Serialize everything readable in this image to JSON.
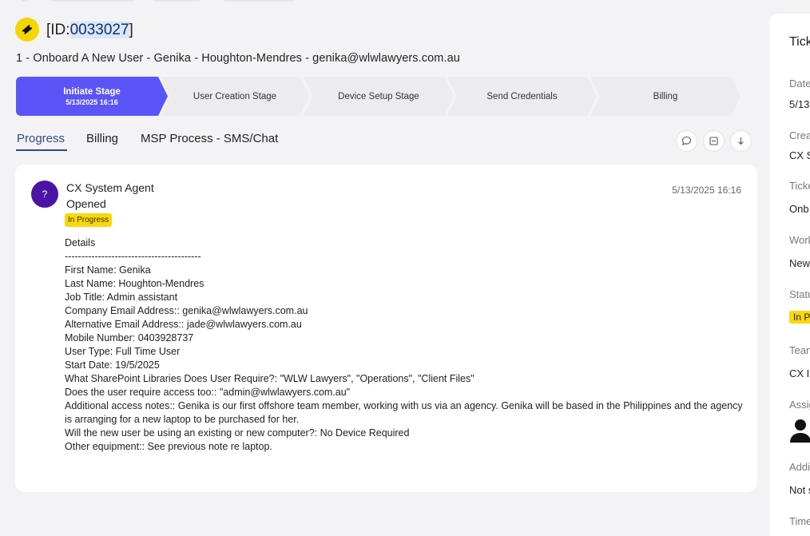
{
  "header": {
    "id_prefix": "[ID:",
    "id_number": "0033027",
    "id_suffix": "]",
    "title": "1 - Onboard A New User - Genika - Houghton-Mendres - genika@wlwlawyers.com.au"
  },
  "stages": [
    {
      "label": "Initiate Stage",
      "date": "5/13/2025 16:16"
    },
    {
      "label": "User Creation Stage"
    },
    {
      "label": "Device Setup Stage"
    },
    {
      "label": "Send Credentials"
    },
    {
      "label": "Billing"
    }
  ],
  "tabs": [
    {
      "label": "Progress"
    },
    {
      "label": "Billing"
    },
    {
      "label": "MSP Process - SMS/Chat"
    }
  ],
  "entry": {
    "avatar_letter": "?",
    "agent": "CX System Agent",
    "status": "Opened",
    "badge": "In Progress",
    "timestamp": "5/13/2025 16:16",
    "details": [
      "Details",
      "-----------------------------------------",
      "First Name: Genika",
      "Last Name: Houghton-Mendres",
      "Job Title: Admin assistant",
      "Company Email Address:: genika@wlwlawyers.com.au",
      "Alternative Email Address:: jade@wlwlawyers.com.au",
      "Mobile Number: 0403928737",
      "User Type: Full Time User",
      "Start Date: 19/5/2025",
      "What SharePoint Libraries Does User Require?: \"WLW Lawyers\", \"Operations\", \"Client Files\"",
      "Does the user require access too:: \"admin@wlwlawyers.com.au\"",
      "Additional access notes:: Genika is our first offshore team member, working with us via an agency. Genika will be based in the Philippines and the agency is arranging for a new laptop to be purchased for her.",
      "Will the new user be using an existing or new computer?: No Device Required",
      "Other equipment:: See previous note re laptop."
    ]
  },
  "right_panel": {
    "heading": "Tick",
    "fields": [
      {
        "label": "Date",
        "value": "5/13"
      },
      {
        "label": "Crea",
        "value": "CX S"
      },
      {
        "label": "Ticke",
        "value": "Onb"
      },
      {
        "label": "Work",
        "value": "New"
      },
      {
        "label": "Statu",
        "value": "In P"
      },
      {
        "label": "Tean",
        "value": "CX I"
      },
      {
        "label": "Assig",
        "value": ""
      },
      {
        "label": "Addi",
        "value": "Not s"
      },
      {
        "label": "Time",
        "value": ""
      }
    ]
  },
  "colors": {
    "accent": "#5b55f7",
    "badge": "#f9d80a",
    "avatar": "#4a14a5",
    "tab_active": "#2d4f7c"
  }
}
